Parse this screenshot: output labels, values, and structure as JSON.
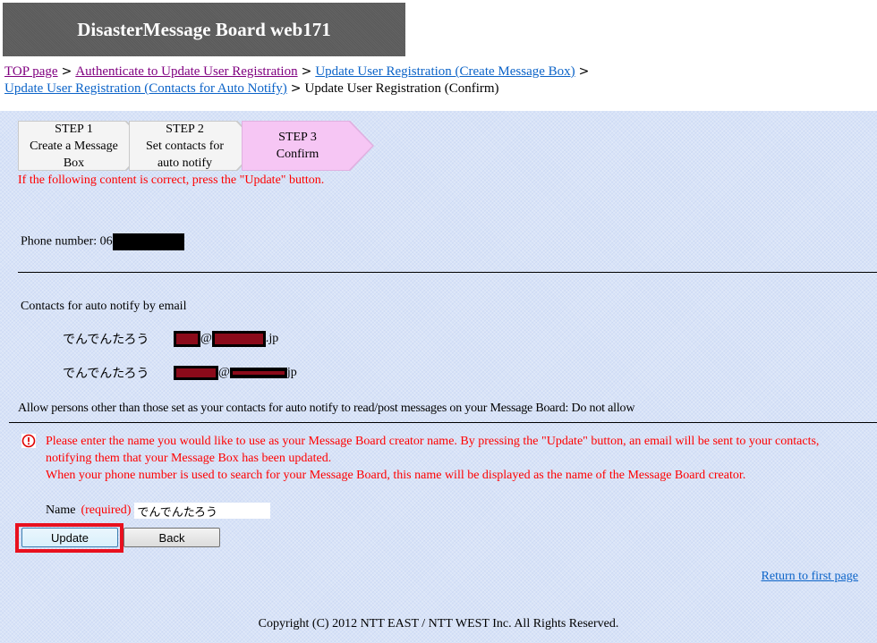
{
  "header": {
    "title": "DisasterMessage Board web171"
  },
  "breadcrumb": {
    "separator": ">",
    "items": [
      {
        "label": "TOP page",
        "state": "visited"
      },
      {
        "label": "Authenticate to Update User Registration",
        "state": "visited"
      },
      {
        "label": "Update User Registration (Create Message Box)",
        "state": "link"
      },
      {
        "label": "Update User Registration (Contacts for Auto Notify)",
        "state": "link"
      },
      {
        "label": "Update User Registration (Confirm)",
        "state": "current"
      }
    ]
  },
  "steps": [
    {
      "title": "STEP 1",
      "label_line1": "Create a Message",
      "label_line2": "Box",
      "active": false
    },
    {
      "title": "STEP 2",
      "label_line1": "Set contacts for",
      "label_line2": "auto notify",
      "active": false
    },
    {
      "title": "STEP 3",
      "label_line1": "Confirm",
      "label_line2": "",
      "active": true
    }
  ],
  "instruction": "If the following content is correct, press the \"Update\" button.",
  "phone": {
    "label": "Phone number",
    "colon": ":",
    "prefix": "06"
  },
  "contacts": {
    "title": "Contacts for auto notify by email",
    "items": [
      {
        "name": "でんでんたろう",
        "at": "@",
        "domain_suffix": ".jp"
      },
      {
        "name": "でんでんたろう",
        "at": "@",
        "domain_suffix": "jp"
      }
    ]
  },
  "allow_setting": "Allow persons other than those set as your contacts for auto notify to read/post messages on your Message Board: Do not allow",
  "notice": {
    "icon": "warning-circle-icon",
    "line1": "Please enter the name you would like to use as your Message Board creator name. By pressing the \"Update\" button, an email will be sent to your contacts, notifying them that your Message Box has been updated.",
    "line2": "When your phone number is used to search for your Message Board, this name will be displayed as the name of the Message Board creator."
  },
  "name_field": {
    "label": "Name",
    "required": "(required)",
    "value": "でんでんたろう"
  },
  "buttons": {
    "update": "Update",
    "back": "Back"
  },
  "return_link": "Return to first page",
  "copyright": "Copyright (C) 2012 NTT EAST / NTT WEST Inc. All Rights Reserved.",
  "colors": {
    "accent_red": "#ff0000",
    "link_blue": "#0b63c8",
    "visited_purple": "#800080",
    "highlight_red": "#e8101e",
    "active_step": "#f6c6f4",
    "background": "#d8e3f7"
  }
}
